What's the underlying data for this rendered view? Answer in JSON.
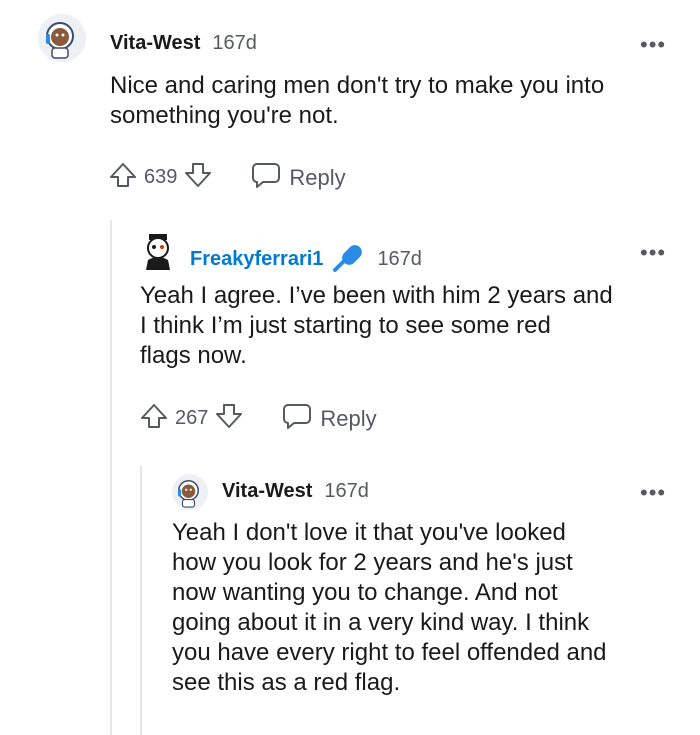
{
  "comments": [
    {
      "username": "Vita-West",
      "time": "167d",
      "more": "•••",
      "lines": [
        "Nice and caring men don't try to make you into",
        "something you're not."
      ],
      "score": "639",
      "reply_label": "Reply"
    },
    {
      "username": "Freakyferrari1",
      "time": "167d",
      "more": "•••",
      "lines": [
        "Yeah I agree. I’ve been with him 2 years and",
        "I think I’m just starting to see some red",
        "flags now."
      ],
      "score": "267",
      "reply_label": "Reply"
    },
    {
      "username": "Vita-West",
      "time": "167d",
      "more": "•••",
      "lines": [
        "Yeah I don't love it that you've looked",
        "how you look for 2 years and he's just",
        "now wanting you to change. And not",
        "going about it in a very kind way. I think",
        "you have every right to feel offended and",
        "see this as a red flag."
      ]
    }
  ],
  "icons": {
    "upvote": "upvote-arrow-icon",
    "downvote": "downvote-arrow-icon",
    "reply": "speech-bubble-icon",
    "flair": "microphone-icon"
  },
  "colors": {
    "username_highlight": "#0079d3",
    "muted": "#555a5e",
    "thread_line": "#e4e6e8"
  }
}
